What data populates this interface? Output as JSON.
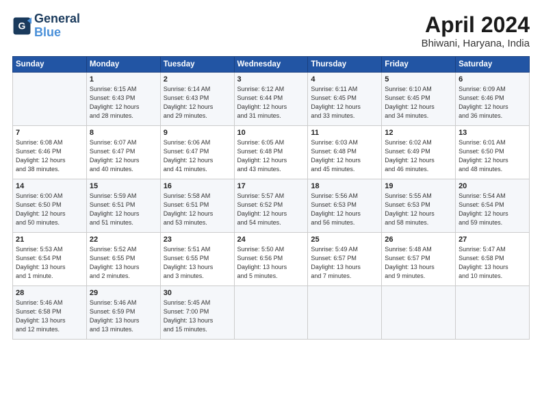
{
  "logo": {
    "line1": "General",
    "line2": "Blue"
  },
  "title": "April 2024",
  "location": "Bhiwani, Haryana, India",
  "days_of_week": [
    "Sunday",
    "Monday",
    "Tuesday",
    "Wednesday",
    "Thursday",
    "Friday",
    "Saturday"
  ],
  "weeks": [
    [
      {
        "day": "",
        "detail": ""
      },
      {
        "day": "1",
        "detail": "Sunrise: 6:15 AM\nSunset: 6:43 PM\nDaylight: 12 hours\nand 28 minutes."
      },
      {
        "day": "2",
        "detail": "Sunrise: 6:14 AM\nSunset: 6:43 PM\nDaylight: 12 hours\nand 29 minutes."
      },
      {
        "day": "3",
        "detail": "Sunrise: 6:12 AM\nSunset: 6:44 PM\nDaylight: 12 hours\nand 31 minutes."
      },
      {
        "day": "4",
        "detail": "Sunrise: 6:11 AM\nSunset: 6:45 PM\nDaylight: 12 hours\nand 33 minutes."
      },
      {
        "day": "5",
        "detail": "Sunrise: 6:10 AM\nSunset: 6:45 PM\nDaylight: 12 hours\nand 34 minutes."
      },
      {
        "day": "6",
        "detail": "Sunrise: 6:09 AM\nSunset: 6:46 PM\nDaylight: 12 hours\nand 36 minutes."
      }
    ],
    [
      {
        "day": "7",
        "detail": "Sunrise: 6:08 AM\nSunset: 6:46 PM\nDaylight: 12 hours\nand 38 minutes."
      },
      {
        "day": "8",
        "detail": "Sunrise: 6:07 AM\nSunset: 6:47 PM\nDaylight: 12 hours\nand 40 minutes."
      },
      {
        "day": "9",
        "detail": "Sunrise: 6:06 AM\nSunset: 6:47 PM\nDaylight: 12 hours\nand 41 minutes."
      },
      {
        "day": "10",
        "detail": "Sunrise: 6:05 AM\nSunset: 6:48 PM\nDaylight: 12 hours\nand 43 minutes."
      },
      {
        "day": "11",
        "detail": "Sunrise: 6:03 AM\nSunset: 6:48 PM\nDaylight: 12 hours\nand 45 minutes."
      },
      {
        "day": "12",
        "detail": "Sunrise: 6:02 AM\nSunset: 6:49 PM\nDaylight: 12 hours\nand 46 minutes."
      },
      {
        "day": "13",
        "detail": "Sunrise: 6:01 AM\nSunset: 6:50 PM\nDaylight: 12 hours\nand 48 minutes."
      }
    ],
    [
      {
        "day": "14",
        "detail": "Sunrise: 6:00 AM\nSunset: 6:50 PM\nDaylight: 12 hours\nand 50 minutes."
      },
      {
        "day": "15",
        "detail": "Sunrise: 5:59 AM\nSunset: 6:51 PM\nDaylight: 12 hours\nand 51 minutes."
      },
      {
        "day": "16",
        "detail": "Sunrise: 5:58 AM\nSunset: 6:51 PM\nDaylight: 12 hours\nand 53 minutes."
      },
      {
        "day": "17",
        "detail": "Sunrise: 5:57 AM\nSunset: 6:52 PM\nDaylight: 12 hours\nand 54 minutes."
      },
      {
        "day": "18",
        "detail": "Sunrise: 5:56 AM\nSunset: 6:53 PM\nDaylight: 12 hours\nand 56 minutes."
      },
      {
        "day": "19",
        "detail": "Sunrise: 5:55 AM\nSunset: 6:53 PM\nDaylight: 12 hours\nand 58 minutes."
      },
      {
        "day": "20",
        "detail": "Sunrise: 5:54 AM\nSunset: 6:54 PM\nDaylight: 12 hours\nand 59 minutes."
      }
    ],
    [
      {
        "day": "21",
        "detail": "Sunrise: 5:53 AM\nSunset: 6:54 PM\nDaylight: 13 hours\nand 1 minute."
      },
      {
        "day": "22",
        "detail": "Sunrise: 5:52 AM\nSunset: 6:55 PM\nDaylight: 13 hours\nand 2 minutes."
      },
      {
        "day": "23",
        "detail": "Sunrise: 5:51 AM\nSunset: 6:55 PM\nDaylight: 13 hours\nand 3 minutes."
      },
      {
        "day": "24",
        "detail": "Sunrise: 5:50 AM\nSunset: 6:56 PM\nDaylight: 13 hours\nand 5 minutes."
      },
      {
        "day": "25",
        "detail": "Sunrise: 5:49 AM\nSunset: 6:57 PM\nDaylight: 13 hours\nand 7 minutes."
      },
      {
        "day": "26",
        "detail": "Sunrise: 5:48 AM\nSunset: 6:57 PM\nDaylight: 13 hours\nand 9 minutes."
      },
      {
        "day": "27",
        "detail": "Sunrise: 5:47 AM\nSunset: 6:58 PM\nDaylight: 13 hours\nand 10 minutes."
      }
    ],
    [
      {
        "day": "28",
        "detail": "Sunrise: 5:46 AM\nSunset: 6:58 PM\nDaylight: 13 hours\nand 12 minutes."
      },
      {
        "day": "29",
        "detail": "Sunrise: 5:46 AM\nSunset: 6:59 PM\nDaylight: 13 hours\nand 13 minutes."
      },
      {
        "day": "30",
        "detail": "Sunrise: 5:45 AM\nSunset: 7:00 PM\nDaylight: 13 hours\nand 15 minutes."
      },
      {
        "day": "",
        "detail": ""
      },
      {
        "day": "",
        "detail": ""
      },
      {
        "day": "",
        "detail": ""
      },
      {
        "day": "",
        "detail": ""
      }
    ]
  ]
}
